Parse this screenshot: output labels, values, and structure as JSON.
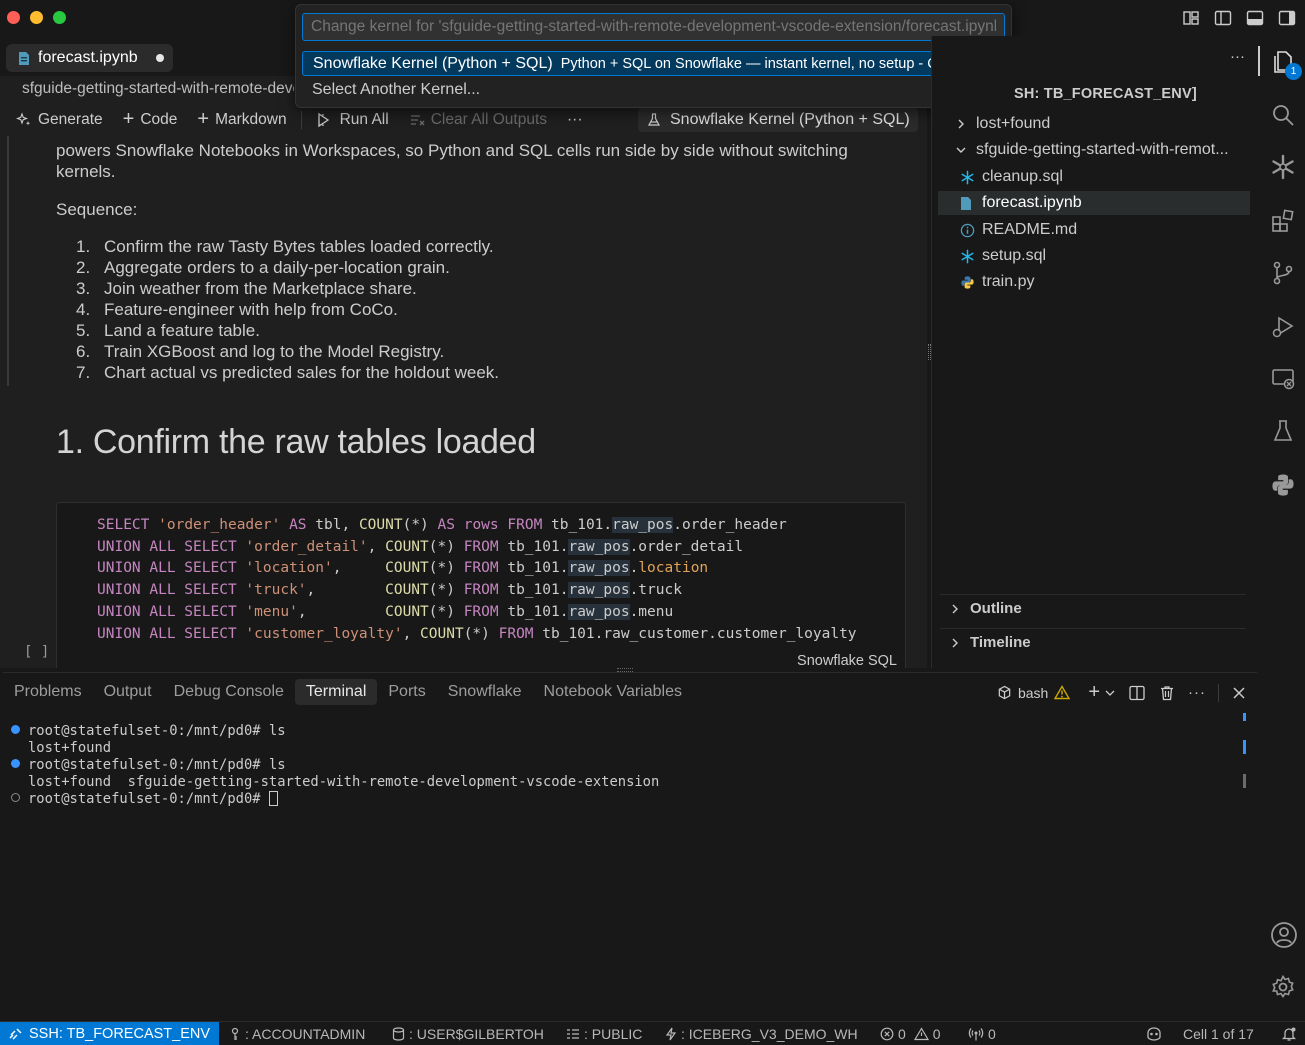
{
  "quickpick": {
    "placeholder": "Change kernel for 'sfguide-getting-started-with-remote-development-vscode-extension/forecast.ipynb'",
    "item1_label": "Snowflake Kernel (Python + SQL)",
    "item1_desc": "Python + SQL on Snowflake — instant kernel, no setup - Currently Selected",
    "item2_label": "Select Another Kernel..."
  },
  "tab": {
    "label": "forecast.ipynb"
  },
  "breadcrumb": "sfguide-getting-started-with-remote-development-vscode-extension",
  "toolbar": {
    "generate": "Generate",
    "code": "Code",
    "markdown": "Markdown",
    "run_all": "Run All",
    "clear_all": "Clear All Outputs",
    "more": "···",
    "kernel": "Snowflake Kernel (Python + SQL)"
  },
  "notebook": {
    "intro_line1": "powers Snowflake Notebooks in Workspaces, so Python and SQL cells run side by side without switching",
    "intro_line2": "kernels.",
    "sequence_label": "Sequence:",
    "steps": [
      {
        "n": "1.",
        "text": "Confirm the raw Tasty Bytes tables loaded correctly."
      },
      {
        "n": "2.",
        "text": "Aggregate orders to a daily-per-location grain."
      },
      {
        "n": "3.",
        "text": "Join weather from the Marketplace share."
      },
      {
        "n": "4.",
        "text": "Feature-engineer with help from CoCo."
      },
      {
        "n": "5.",
        "text": "Land a feature table."
      },
      {
        "n": "6.",
        "text": "Train XGBoost and log to the Model Registry."
      },
      {
        "n": "7.",
        "text": "Chart actual vs predicted sales for the holdout week."
      }
    ],
    "heading": "1. Confirm the raw tables loaded",
    "cell_language": "Snowflake SQL",
    "cell_exec": "[ ]"
  },
  "explorer": {
    "title": "SH: TB_FORECAST_ENV]",
    "items": [
      {
        "label": "lost+found"
      },
      {
        "label": "sfguide-getting-started-with-remot..."
      },
      {
        "label": "cleanup.sql"
      },
      {
        "label": "forecast.ipynb"
      },
      {
        "label": "README.md"
      },
      {
        "label": "setup.sql"
      },
      {
        "label": "train.py"
      }
    ],
    "outline": "Outline",
    "timeline": "Timeline",
    "more": "···"
  },
  "activity": {
    "badge": "1"
  },
  "panel": {
    "tabs": [
      "Problems",
      "Output",
      "Debug Console",
      "Terminal",
      "Ports",
      "Snowflake",
      "Notebook Variables"
    ],
    "shell": "bash",
    "terminal_lines": [
      "root@statefulset-0:/mnt/pd0# ls",
      "lost+found",
      "root@statefulset-0:/mnt/pd0# ls",
      "lost+found  sfguide-getting-started-with-remote-development-vscode-extension",
      "root@statefulset-0:/mnt/pd0# "
    ]
  },
  "status": {
    "remote": "SSH: TB_FORECAST_ENV",
    "role": ": ACCOUNTADMIN",
    "database": ": USER$GILBERTOH",
    "schema": ": PUBLIC",
    "warehouse": ": ICEBERG_V3_DEMO_WH",
    "errors": "0",
    "warnings": "0",
    "ports": "0",
    "cell": "Cell 1 of 17"
  },
  "colors": {
    "accent": "#0078d4",
    "quickpick_selected": "#04395e"
  }
}
